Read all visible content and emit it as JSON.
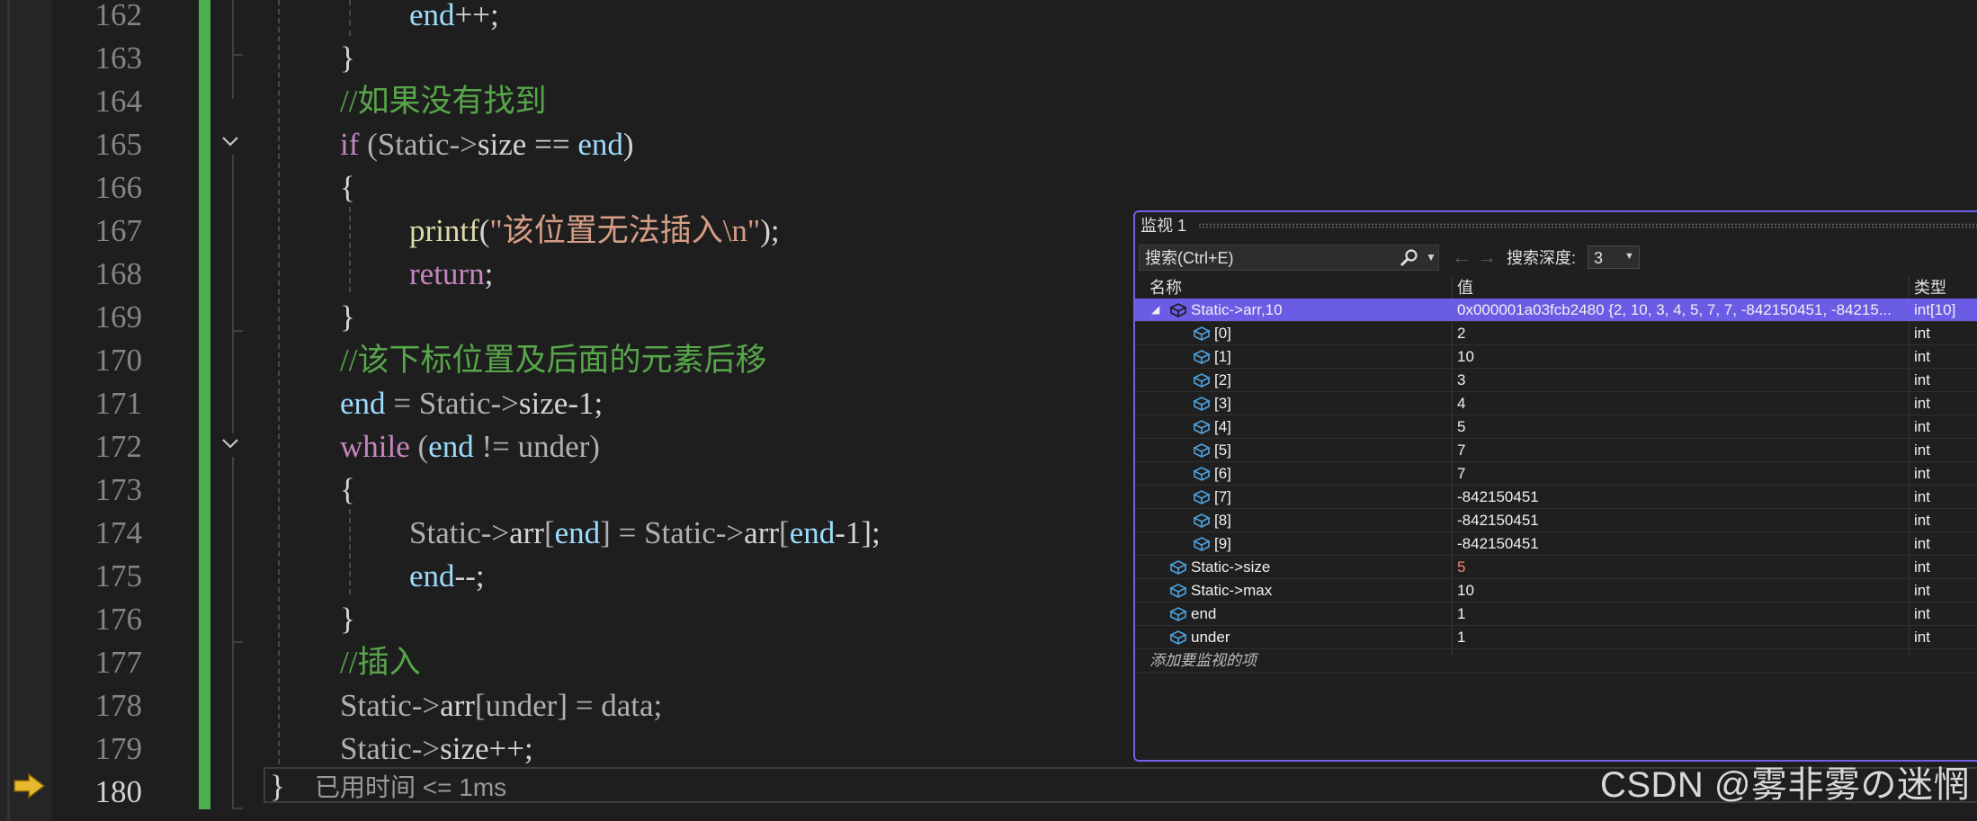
{
  "line_numbers": [
    "162",
    "163",
    "164",
    "165",
    "166",
    "167",
    "168",
    "169",
    "170",
    "171",
    "172",
    "173",
    "174",
    "175",
    "176",
    "177",
    "178",
    "179",
    "180"
  ],
  "code": {
    "l162": {
      "ident": "end",
      "op": "++;"
    },
    "l163": {
      "brace": "}"
    },
    "l164": {
      "comment": "//如果没有找到"
    },
    "l165": {
      "kw": "if",
      "open": " (Static->",
      "member": "size",
      "mid": " == ",
      "ident": "end",
      "close": ")"
    },
    "l166": {
      "brace": "{"
    },
    "l167": {
      "fn": "printf",
      "open": "(",
      "str": "\"该位置无法插入\\n\"",
      "close": ");"
    },
    "l168": {
      "kw": "return",
      "semi": ";"
    },
    "l169": {
      "brace": "}"
    },
    "l170": {
      "comment": "//该下标位置及后面的元素后移"
    },
    "l171": {
      "ident": "end",
      "mid": " = Static->",
      "member": "size",
      "tail": "-1;"
    },
    "l172": {
      "kw": "while",
      "open": " (",
      "ident": "end",
      "mid": " != under)"
    },
    "l173": {
      "brace": "{"
    },
    "l174": {
      "s1": "Static->",
      "m1": "arr",
      "b1": "[",
      "i1": "end",
      "b2": "] = Static->",
      "m2": "arr",
      "b3": "[",
      "i2": "end",
      "tail": "-1];"
    },
    "l175": {
      "ident": "end",
      "op": "--;"
    },
    "l176": {
      "brace": "}"
    },
    "l177": {
      "comment": "//插入"
    },
    "l178": {
      "s1": "Static->",
      "m1": "arr",
      "tail": "[under] = data;"
    },
    "l179": {
      "s1": "Static->",
      "m1": "size",
      "tail": "++;"
    },
    "l180": {
      "brace": "}"
    }
  },
  "perf_tip": "已用时间 <= 1ms",
  "watermark": "CSDN @雾非雾の迷惘",
  "watch": {
    "title": "监视 1",
    "search_placeholder": "搜索(Ctrl+E)",
    "depth_label": "搜索深度:",
    "depth_value": "3",
    "headers": {
      "name": "名称",
      "value": "值",
      "type": "类型"
    },
    "rows": [
      {
        "name": "Static->arr,10",
        "value": "0x000001a03fcb2480 {2, 10, 3, 4, 5, 7, 7, -842150451, -84215...",
        "type": "int[10]"
      },
      {
        "name": "[0]",
        "value": "2",
        "type": "int"
      },
      {
        "name": "[1]",
        "value": "10",
        "type": "int"
      },
      {
        "name": "[2]",
        "value": "3",
        "type": "int"
      },
      {
        "name": "[3]",
        "value": "4",
        "type": "int"
      },
      {
        "name": "[4]",
        "value": "5",
        "type": "int"
      },
      {
        "name": "[5]",
        "value": "7",
        "type": "int"
      },
      {
        "name": "[6]",
        "value": "7",
        "type": "int"
      },
      {
        "name": "[7]",
        "value": "-842150451",
        "type": "int"
      },
      {
        "name": "[8]",
        "value": "-842150451",
        "type": "int"
      },
      {
        "name": "[9]",
        "value": "-842150451",
        "type": "int"
      },
      {
        "name": "Static->size",
        "value": "5",
        "type": "int"
      },
      {
        "name": "Static->max",
        "value": "10",
        "type": "int"
      },
      {
        "name": "end",
        "value": "1",
        "type": "int"
      },
      {
        "name": "under",
        "value": "1",
        "type": "int"
      }
    ],
    "add_item": "添加要监视的项",
    "colors": {
      "selection": "#6b5ce6",
      "changed_value": "#f48771",
      "border": "#7160e8"
    }
  },
  "colors": {
    "change_bar": "#4caf50",
    "keyword": "#c586c0",
    "variable": "#9cdcfe",
    "function": "#dcdcaa",
    "string": "#d69d85",
    "comment": "#57a64a"
  }
}
